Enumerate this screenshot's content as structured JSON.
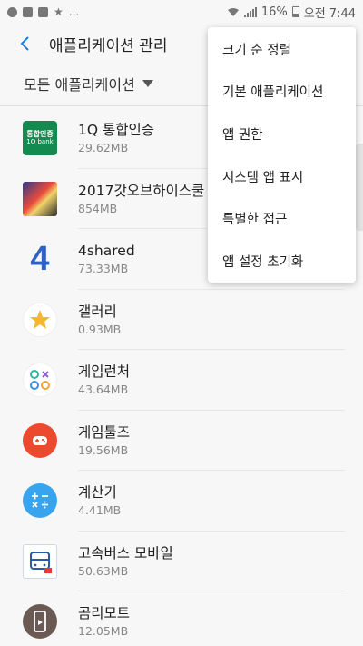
{
  "status_bar": {
    "battery": "16%",
    "time": "오전 7:44",
    "overflow": "..."
  },
  "header": {
    "back_icon": "back-arrow-icon",
    "title": "애플리케이션 관리"
  },
  "filter": {
    "label": "모든 애플리케이션"
  },
  "apps": [
    {
      "name": "1Q 통합인증",
      "size": "29.62MB",
      "icon": "1q-bank-icon",
      "icon_text": "통합인증",
      "icon_subtext": "1Q bank"
    },
    {
      "name": "2017갓오브하이스쿨",
      "size": "854MB",
      "icon": "anime-character-icon"
    },
    {
      "name": "4shared",
      "size": "73.33MB",
      "icon": "4shared-icon",
      "icon_text": "4"
    },
    {
      "name": "갤러리",
      "size": "0.93MB",
      "icon": "gallery-flower-icon"
    },
    {
      "name": "게임런처",
      "size": "43.64MB",
      "icon": "game-launcher-icon"
    },
    {
      "name": "게임툴즈",
      "size": "19.56MB",
      "icon": "gamepad-icon"
    },
    {
      "name": "계산기",
      "size": "4.41MB",
      "icon": "calculator-icon"
    },
    {
      "name": "고속버스 모바일",
      "size": "50.63MB",
      "icon": "bus-icon"
    },
    {
      "name": "곰리모트",
      "size": "12.05MB",
      "icon": "remote-icon"
    }
  ],
  "menu": {
    "items": [
      "크기 순 정렬",
      "기본 애플리케이션",
      "앱 권한",
      "시스템 앱 표시",
      "특별한 접근",
      "앱 설정 초기화"
    ]
  },
  "colors": {
    "accent": "#1e7fd6",
    "background": "#f7f7f7"
  }
}
